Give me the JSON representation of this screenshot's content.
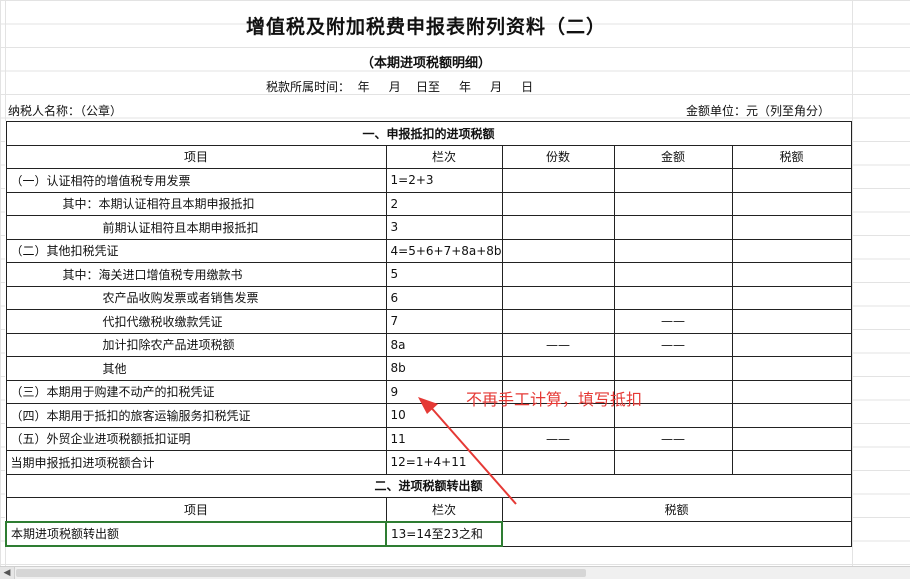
{
  "doc": {
    "title": "增值税及附加税费申报表附列资料（二）",
    "subtitle": "（本期进项税额明细）",
    "period": "税款所属时间：  年     月    日至     年     月     日",
    "taxpayer": "纳税人名称：（公章）",
    "unit": "金额单位：元（列至角分）"
  },
  "section1": {
    "title": "一、申报抵扣的进项税额",
    "headers": [
      "项目",
      "栏次",
      "份数",
      "金额",
      "税额"
    ],
    "rows": [
      {
        "item": "（一）认证相符的增值税专用发票",
        "line": "1=2+3",
        "count": "",
        "amount": "",
        "tax": ""
      },
      {
        "item": "其中：本期认证相符且本期申报抵扣",
        "line": "2",
        "count": "",
        "amount": "",
        "tax": ""
      },
      {
        "item": "前期认证相符且本期申报抵扣",
        "line": "3",
        "count": "",
        "amount": "",
        "tax": ""
      },
      {
        "item": "（二）其他扣税凭证",
        "line": "4=5+6+7+8a+8b",
        "count": "",
        "amount": "",
        "tax": ""
      },
      {
        "item": "其中：海关进口增值税专用缴款书",
        "line": "5",
        "count": "",
        "amount": "",
        "tax": ""
      },
      {
        "item": "农产品收购发票或者销售发票",
        "line": "6",
        "count": "",
        "amount": "",
        "tax": ""
      },
      {
        "item": "代扣代缴税收缴款凭证",
        "line": "7",
        "count": "",
        "amount": "——",
        "tax": ""
      },
      {
        "item": "加计扣除农产品进项税额",
        "line": "8a",
        "count": "——",
        "amount": "——",
        "tax": ""
      },
      {
        "item": "其他",
        "line": "8b",
        "count": "",
        "amount": "",
        "tax": ""
      },
      {
        "item": "（三）本期用于购建不动产的扣税凭证",
        "line": "9",
        "count": "",
        "amount": "",
        "tax": ""
      },
      {
        "item": "（四）本期用于抵扣的旅客运输服务扣税凭证",
        "line": "10",
        "count": "",
        "amount": "",
        "tax": ""
      },
      {
        "item": "（五）外贸企业进项税额抵扣证明",
        "line": "11",
        "count": "——",
        "amount": "——",
        "tax": ""
      },
      {
        "item": "当期申报抵扣进项税额合计",
        "line": "12=1+4+11",
        "count": "",
        "amount": "",
        "tax": ""
      }
    ]
  },
  "section2": {
    "title": "二、进项税额转出额",
    "headers": [
      "项目",
      "栏次",
      "税额"
    ],
    "rows": [
      {
        "item": "本期进项税额转出额",
        "line": "13=14至23之和",
        "tax": ""
      }
    ]
  },
  "annotation": {
    "text": "不再手工计算，填写抵扣",
    "color": "#e53935"
  }
}
